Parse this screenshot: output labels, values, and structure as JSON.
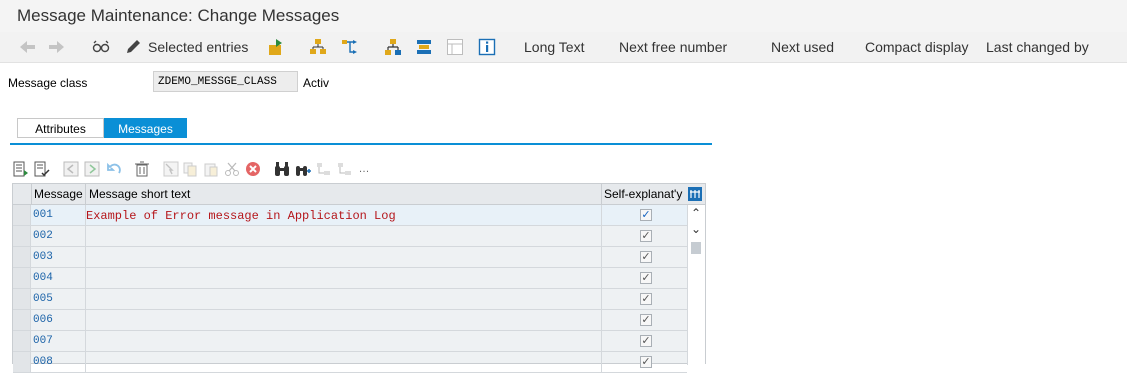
{
  "window": {
    "title": "Message Maintenance: Change Messages"
  },
  "toolbar": {
    "icons": [
      "back-arrow-icon",
      "forward-arrow-icon",
      "display-change-glasses-icon",
      "pencil-icon"
    ],
    "selected_entries": "Selected entries",
    "long_text": "Long Text",
    "next_free_number": "Next free number",
    "next_used": "Next used",
    "compact_display": "Compact display",
    "last_changed_by": "Last changed by"
  },
  "header": {
    "message_class_label": "Message class",
    "message_class_value": "ZDEMO_MESSGE_CLASS",
    "status": "Activ"
  },
  "tabs": {
    "attributes": "Attributes",
    "messages": "Messages"
  },
  "grid": {
    "columns": {
      "message": "Message",
      "short_text": "Message short text",
      "self_explanatory": "Self-explanat'y"
    },
    "rows": [
      {
        "message": "001",
        "text": "Example of Error message in Application Log",
        "checked": "✓"
      },
      {
        "message": "002",
        "text": "",
        "checked": "✓"
      },
      {
        "message": "003",
        "text": "",
        "checked": "✓"
      },
      {
        "message": "004",
        "text": "",
        "checked": "✓"
      },
      {
        "message": "005",
        "text": "",
        "checked": "✓"
      },
      {
        "message": "006",
        "text": "",
        "checked": "✓"
      },
      {
        "message": "007",
        "text": "",
        "checked": "✓"
      },
      {
        "message": "008",
        "text": "",
        "checked": "✓"
      }
    ]
  },
  "colors": {
    "accent": "#0a8fd6",
    "message_text": "#b5161b",
    "message_number": "#1a62a8"
  }
}
